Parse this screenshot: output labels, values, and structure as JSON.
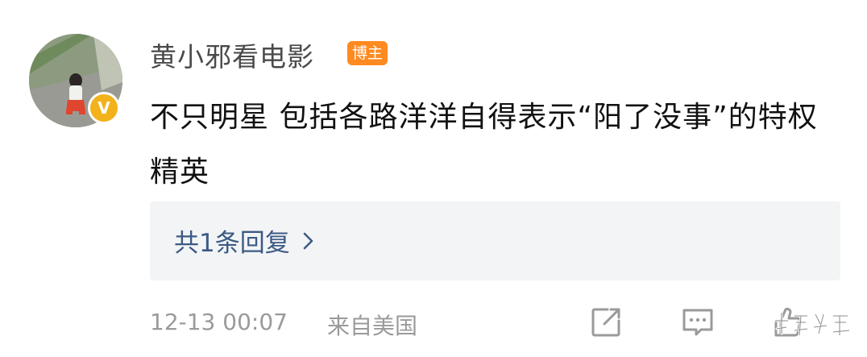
{
  "post": {
    "author": {
      "name": "黄小邪看电影",
      "badge": "博主",
      "verified_icon": "verified-v-icon"
    },
    "content": "不只明星 包括各路洋洋自得表示“阳了没事”的特权精英",
    "replies": {
      "label": "共1条回复",
      "chevron_icon": "chevron-right-icon"
    },
    "footer": {
      "timestamp": "12-13 00:07",
      "source": "来自美国",
      "actions": [
        "share-icon",
        "comment-icon",
        "like-icon"
      ]
    }
  },
  "colors": {
    "badge_orange": "#ff8a1f",
    "verified_gold": "#f2b21b",
    "link_blue": "#3c5a84",
    "muted_gray": "#9a9a9a",
    "reply_bg": "#f3f4f6"
  }
}
